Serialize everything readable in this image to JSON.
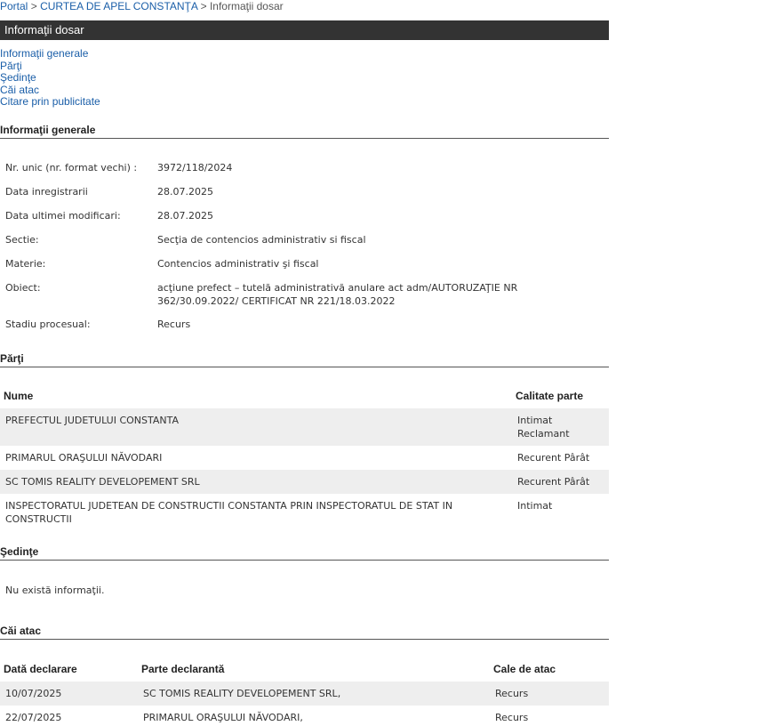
{
  "breadcrumb": {
    "portal": "Portal",
    "sep1": ">",
    "court": "CURTEA DE APEL CONSTANŢA",
    "sep2": ">",
    "current": "Informaţii dosar"
  },
  "title_bar": "Informaţii dosar",
  "toc": [
    "Informaţii generale",
    "Părţi",
    "Şedinţe",
    "Căi atac",
    "Citare prin publicitate"
  ],
  "general": {
    "heading": "Informaţii generale",
    "rows": [
      {
        "label": "Nr. unic (nr. format vechi) :",
        "value": "3972/118/2024"
      },
      {
        "label": "Data inregistrarii",
        "value": "28.07.2025"
      },
      {
        "label": "Data ultimei modificari:",
        "value": "28.07.2025"
      },
      {
        "label": "Sectie:",
        "value": "Secţia de contencios administrativ si fiscal"
      },
      {
        "label": "Materie:",
        "value": "Contencios administrativ şi fiscal"
      },
      {
        "label": "Obiect:",
        "value": "acţiune prefect – tutelă administrativă anulare act adm/AUTORUZAŢIE NR 362/30.09.2022/ CERTIFICAT NR 221/18.03.2022"
      },
      {
        "label": "Stadiu procesual:",
        "value": "Recurs"
      }
    ]
  },
  "parti": {
    "heading": "Părţi",
    "col_name": "Nume",
    "col_role": "Calitate parte",
    "rows": [
      {
        "name": "PREFECTUL JUDETULUI CONSTANTA",
        "role": "Intimat\nReclamant"
      },
      {
        "name": "PRIMARUL ORAŞULUI NĂVODARI",
        "role": "Recurent Pârât"
      },
      {
        "name": "SC TOMIS REALITY DEVELOPEMENT SRL",
        "role": "Recurent Pârât"
      },
      {
        "name": "INSPECTORATUL JUDETEAN DE CONSTRUCTII CONSTANTA PRIN INSPECTORATUL DE STAT IN CONSTRUCTII",
        "role": "Intimat"
      }
    ]
  },
  "sedinte": {
    "heading": "Şedinţe",
    "empty_text": "Nu există informaţii."
  },
  "cai_atac": {
    "heading": "Căi atac",
    "col_date": "Dată declarare",
    "col_party": "Parte declarantă",
    "col_type": "Cale de atac",
    "rows": [
      {
        "date": "10/07/2025",
        "party": "SC TOMIS REALITY DEVELOPEMENT SRL,",
        "type": "Recurs"
      },
      {
        "date": "22/07/2025",
        "party": "PRIMARUL ORAŞULUI NĂVODARI,",
        "type": "Recurs"
      }
    ]
  }
}
